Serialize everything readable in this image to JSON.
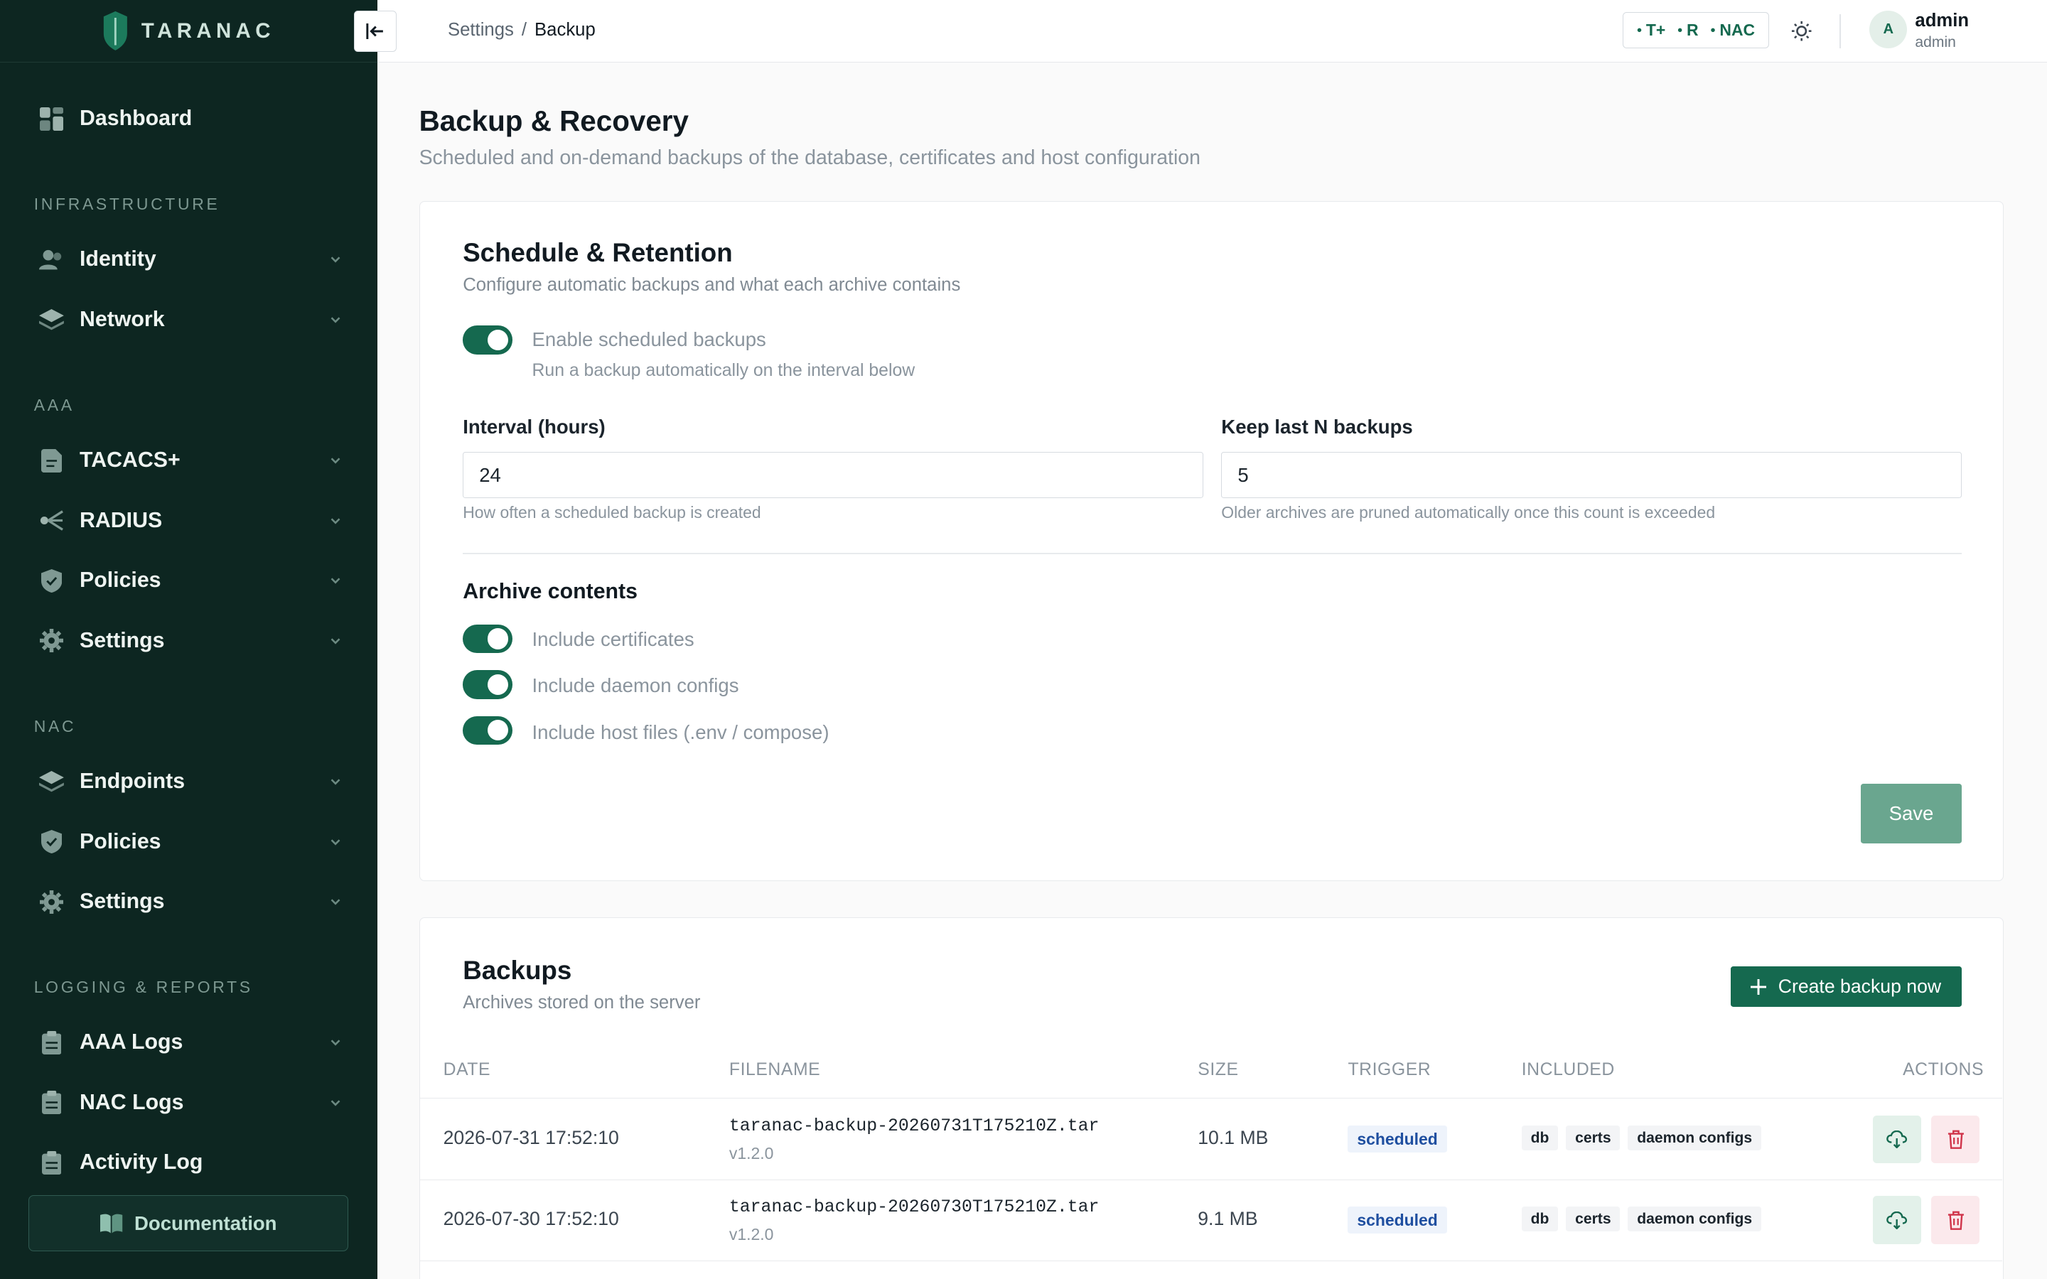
{
  "brand": {
    "name": "TARANAC"
  },
  "sidebar": {
    "dashboard": "Dashboard",
    "sections": [
      {
        "title": "INFRASTRUCTURE",
        "items": [
          {
            "label": "Identity",
            "icon": "users-icon"
          },
          {
            "label": "Network",
            "icon": "layers-icon"
          }
        ]
      },
      {
        "title": "AAA",
        "items": [
          {
            "label": "TACACS+",
            "icon": "file-icon"
          },
          {
            "label": "RADIUS",
            "icon": "radio-waves-icon"
          },
          {
            "label": "Policies",
            "icon": "shield-check-icon"
          },
          {
            "label": "Settings",
            "icon": "gear-icon"
          }
        ]
      },
      {
        "title": "NAC",
        "items": [
          {
            "label": "Endpoints",
            "icon": "layers-icon"
          },
          {
            "label": "Policies",
            "icon": "shield-check-icon"
          },
          {
            "label": "Settings",
            "icon": "gear-icon"
          }
        ]
      },
      {
        "title": "LOGGING & REPORTS",
        "items": [
          {
            "label": "AAA Logs",
            "icon": "log-icon"
          },
          {
            "label": "NAC Logs",
            "icon": "log-icon"
          },
          {
            "label": "Activity Log",
            "icon": "log-icon"
          }
        ]
      }
    ],
    "documentation": "Documentation"
  },
  "topbar": {
    "breadcrumb": {
      "parent": "Settings",
      "separator": "/",
      "current": "Backup"
    },
    "protocols": [
      "T+",
      "R",
      "NAC"
    ],
    "user": {
      "initial": "A",
      "name": "admin",
      "role": "admin"
    }
  },
  "page": {
    "title": "Backup & Recovery",
    "subtitle": "Scheduled and on-demand backups of the database, certificates and host configuration"
  },
  "schedule": {
    "title": "Schedule & Retention",
    "subtitle": "Configure automatic backups and what each archive contains",
    "enable_label": "Enable scheduled backups",
    "enable_hint": "Run a backup automatically on the interval below",
    "enabled": true,
    "interval": {
      "label": "Interval (hours)",
      "value": "24",
      "hint": "How often a scheduled backup is created"
    },
    "keep": {
      "label": "Keep last N backups",
      "value": "5",
      "hint": "Older archives are pruned automatically once this count is exceeded"
    },
    "contents_title": "Archive contents",
    "contents": [
      {
        "label": "Include certificates",
        "on": true
      },
      {
        "label": "Include daemon configs",
        "on": true
      },
      {
        "label": "Include host files (.env / compose)",
        "on": true
      }
    ],
    "save_label": "Save"
  },
  "backups": {
    "title": "Backups",
    "subtitle": "Archives stored on the server",
    "create_label": "Create backup now",
    "columns": {
      "date": "DATE",
      "filename": "FILENAME",
      "size": "SIZE",
      "trigger": "TRIGGER",
      "included": "INCLUDED",
      "actions": "ACTIONS"
    },
    "rows": [
      {
        "date": "2026-07-31 17:52:10",
        "filename": "taranac-backup-20260731T175210Z.tar",
        "version": "v1.2.0",
        "size": "10.1 MB",
        "trigger": "scheduled",
        "included": [
          "db",
          "certs",
          "daemon configs"
        ]
      },
      {
        "date": "2026-07-30 17:52:10",
        "filename": "taranac-backup-20260730T175210Z.tar",
        "version": "v1.2.0",
        "size": "9.1 MB",
        "trigger": "scheduled",
        "included": [
          "db",
          "certs",
          "daemon configs"
        ]
      }
    ]
  },
  "colors": {
    "sidebar_bg": "#0d2621",
    "accent": "#15694f",
    "save_disabled": "#6aa68f",
    "trigger_badge": "#1f4fa0",
    "delete": "#d0344a"
  }
}
